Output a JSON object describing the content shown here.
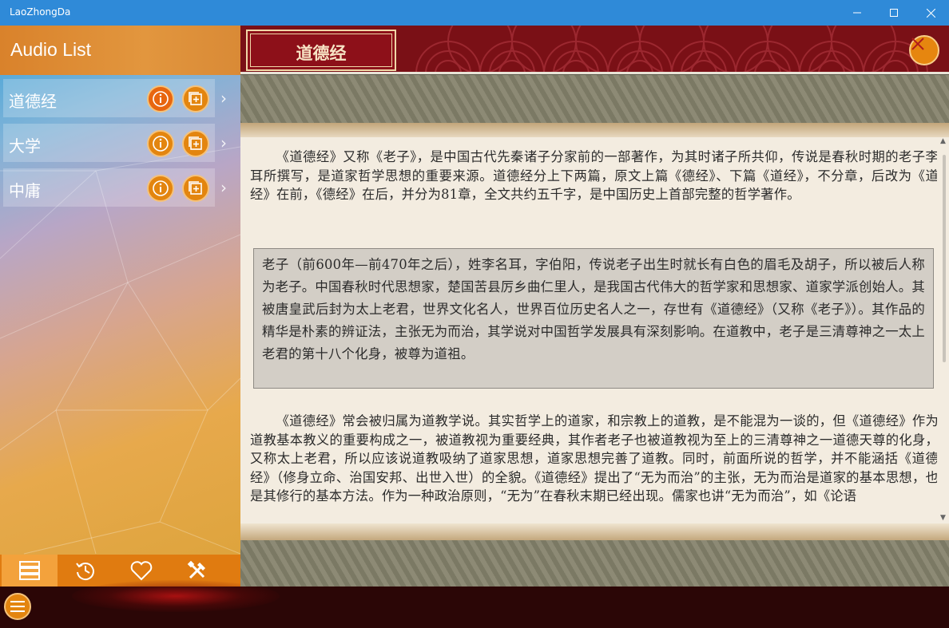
{
  "window": {
    "title": "LaoZhongDa",
    "minimize_icon": "minimize-icon",
    "maximize_icon": "maximize-icon",
    "close_icon": "close-icon"
  },
  "sidebar": {
    "header": "Audio List",
    "items": [
      {
        "label": "道德经",
        "info_icon": "info-icon",
        "add_icon": "add-to-list-icon",
        "chevron_icon": "chevron-right-icon"
      },
      {
        "label": "大学",
        "info_icon": "info-icon",
        "add_icon": "add-to-list-icon",
        "chevron_icon": "chevron-right-icon"
      },
      {
        "label": "中庸",
        "info_icon": "info-icon",
        "add_icon": "add-to-list-icon",
        "chevron_icon": "chevron-right-icon"
      }
    ],
    "bottom_nav": [
      {
        "name": "list",
        "icon": "list-icon",
        "active": true
      },
      {
        "name": "history",
        "icon": "history-icon",
        "active": false
      },
      {
        "name": "favorites",
        "icon": "heart-icon",
        "active": false
      },
      {
        "name": "settings",
        "icon": "tools-icon",
        "active": false
      }
    ],
    "menu_icon": "hamburger-menu-icon"
  },
  "content": {
    "title": "道德经",
    "close_icon": "close-icon",
    "paragraph_1": "《道德经》又称《老子》，是中国古代先秦诸子分家前的一部著作，为其时诸子所共仰，传说是春秋时期的老子李耳所撰写，是道家哲学思想的重要来源。道德经分上下两篇，原文上篇《德经》、下篇《道经》，不分章，后改为《道经》在前，《德经》在后，并分为81章，全文共约五千字，是中国历史上首部完整的哲学著作。",
    "quote": "老子（前600年—前470年之后），姓李名耳，字伯阳，传说老子出生时就长有白色的眉毛及胡子，所以被后人称为老子。中国春秋时代思想家，楚国苦县厉乡曲仁里人，是我国古代伟大的哲学家和思想家、道家学派创始人。其被唐皇武后封为太上老君，世界文化名人，世界百位历史名人之一，存世有《道德经》（又称《老子》）。其作品的精华是朴素的辨证法，主张无为而治，其学说对中国哲学发展具有深刻影响。在道教中，老子是三清尊神之一太上老君的第十八个化身，被尊为道祖。",
    "paragraph_2": "《道德经》常会被归属为道教学说。其实哲学上的道家，和宗教上的道教，是不能混为一谈的，但《道德经》作为道教基本教义的重要构成之一，被道教视为重要经典，其作者老子也被道教视为至上的三清尊神之一道德天尊的化身，又称太上老君，所以应该说道教吸纳了道家思想，道家思想完善了道教。同时，前面所说的哲学，并不能涵括《道德经》（修身立命、治国安邦、出世入世）的全貌。《道德经》提出了“无为而治”的主张，无为而治是道家的基本思想，也是其修行的基本方法。作为一种政治原则，“无为”在春秋末期已经出现。儒家也讲“无为而治”，如《论语"
  }
}
